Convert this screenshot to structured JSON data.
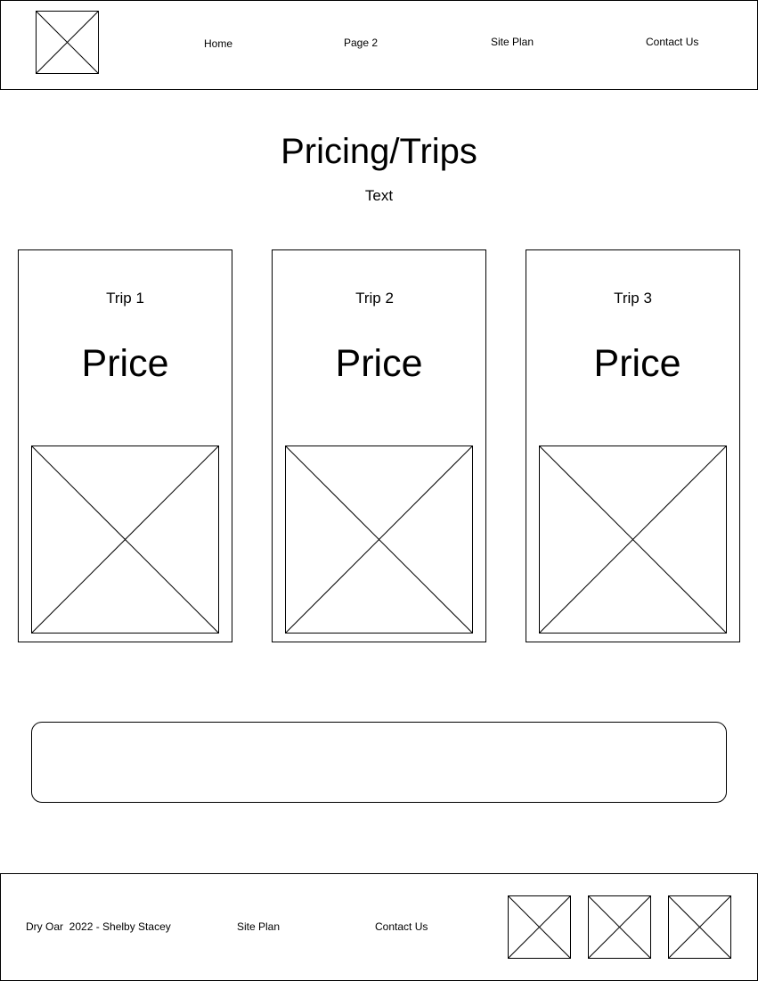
{
  "header": {
    "logo_icon": "image-placeholder-icon",
    "nav": [
      {
        "label": "Home"
      },
      {
        "label": "Page 2"
      },
      {
        "label": "Site Plan"
      },
      {
        "label": "Contact Us"
      }
    ]
  },
  "main": {
    "title": "Pricing/Trips",
    "subtitle": "Text",
    "cards": [
      {
        "title": "Trip 1",
        "price": "Price",
        "image_icon": "image-placeholder-icon"
      },
      {
        "title": "Trip 2",
        "price": "Price",
        "image_icon": "image-placeholder-icon"
      },
      {
        "title": "Trip 3",
        "price": "Price",
        "image_icon": "image-placeholder-icon"
      }
    ],
    "banner_text": ""
  },
  "footer": {
    "copyright": "Dry Oar  2022 - Shelby Stacey",
    "links": [
      {
        "label": "Site Plan"
      },
      {
        "label": "Contact Us"
      }
    ],
    "social_icons": [
      "image-placeholder-icon",
      "image-placeholder-icon",
      "image-placeholder-icon"
    ]
  }
}
